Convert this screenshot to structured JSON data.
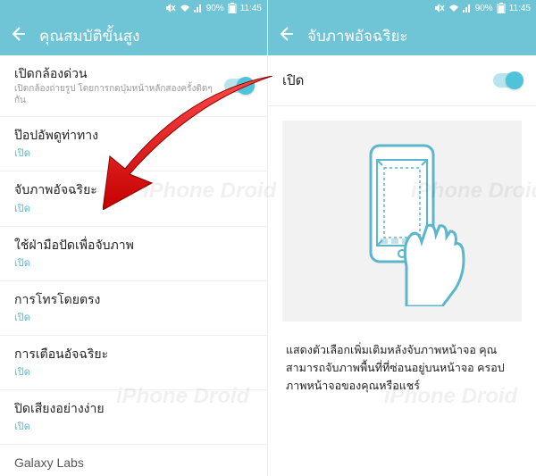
{
  "status": {
    "battery": "90%",
    "time": "11:45"
  },
  "left": {
    "title": "คุณสมบัติขั้นสูง",
    "rows": [
      {
        "title": "เปิดกล้องด่วน",
        "sub": "เปิดกล้องถ่ายรูป โดยการกดปุ่มหน้าหลักสองครั้งติดๆ กัน",
        "status": "",
        "toggle": true
      },
      {
        "title": "ป๊อปอัพดูท่าทาง",
        "sub": "",
        "status": "เปิด",
        "toggle": false
      },
      {
        "title": "จับภาพอัจฉริยะ",
        "sub": "",
        "status": "เปิด",
        "toggle": false
      },
      {
        "title": "ใช้ฝ่ามือปัดเพื่อจับภาพ",
        "sub": "",
        "status": "เปิด",
        "toggle": false
      },
      {
        "title": "การโทรโดยตรง",
        "sub": "",
        "status": "เปิด",
        "toggle": false
      },
      {
        "title": "การเตือนอัจฉริยะ",
        "sub": "",
        "status": "เปิด",
        "toggle": false
      },
      {
        "title": "ปิดเสียงอย่างง่าย",
        "sub": "",
        "status": "เปิด",
        "toggle": false
      }
    ],
    "section": "Galaxy Labs"
  },
  "right": {
    "title": "จับภาพอัจฉริยะ",
    "enable_label": "เปิด",
    "description": "แสดงตัวเลือกเพิ่มเติมหลังจับภาพหน้าจอ คุณสามารถจับภาพพื้นที่ที่ซ่อนอยู่บนหน้าจอ ครอปภาพหน้าจอของคุณหรือแชร์"
  },
  "watermark": "iPhone Droid"
}
